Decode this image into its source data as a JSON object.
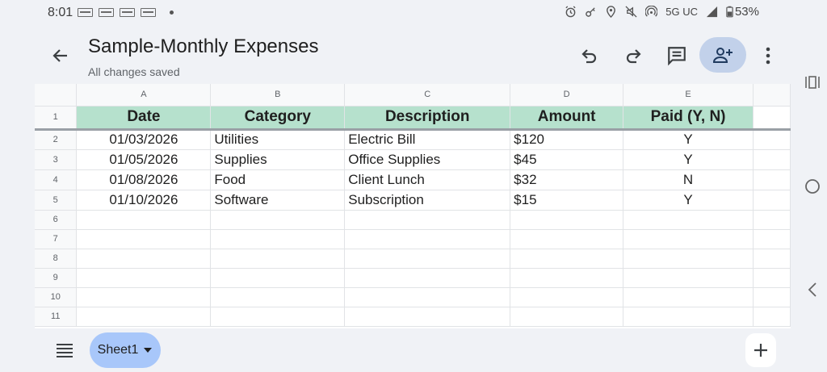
{
  "status_bar": {
    "time": "8:01",
    "network": "5G UC",
    "battery": "53%"
  },
  "header": {
    "title": "Sample-Monthly Expenses",
    "subtitle": "All changes saved"
  },
  "grid": {
    "columns": [
      "A",
      "B",
      "C",
      "D",
      "E"
    ],
    "header_row_number": "1",
    "header": [
      "Date",
      "Category",
      "Description",
      "Amount",
      "Paid (Y, N)"
    ],
    "header_color": "#b6e1cd",
    "rows": [
      {
        "num": "2",
        "cells": [
          "01/03/2026",
          "Utilities",
          "Electric Bill",
          "$120",
          "Y"
        ]
      },
      {
        "num": "3",
        "cells": [
          "01/05/2026",
          "Supplies",
          "Office Supplies",
          "$45",
          "Y"
        ]
      },
      {
        "num": "4",
        "cells": [
          "01/08/2026",
          "Food",
          "Client Lunch",
          "$32",
          "N"
        ]
      },
      {
        "num": "5",
        "cells": [
          "01/10/2026",
          "Software",
          "Subscription",
          "$15",
          "Y"
        ]
      }
    ],
    "empty_rows": [
      "6",
      "7",
      "8",
      "9",
      "10",
      "11"
    ]
  },
  "bottom": {
    "sheet_tab": "Sheet1"
  },
  "icons": {
    "back": "arrow-left-icon",
    "undo": "undo-icon",
    "redo": "redo-icon",
    "comment": "comment-icon",
    "share": "add-person-icon",
    "more": "more-vert-icon",
    "menu": "sheets-list-icon",
    "add": "plus-icon"
  }
}
